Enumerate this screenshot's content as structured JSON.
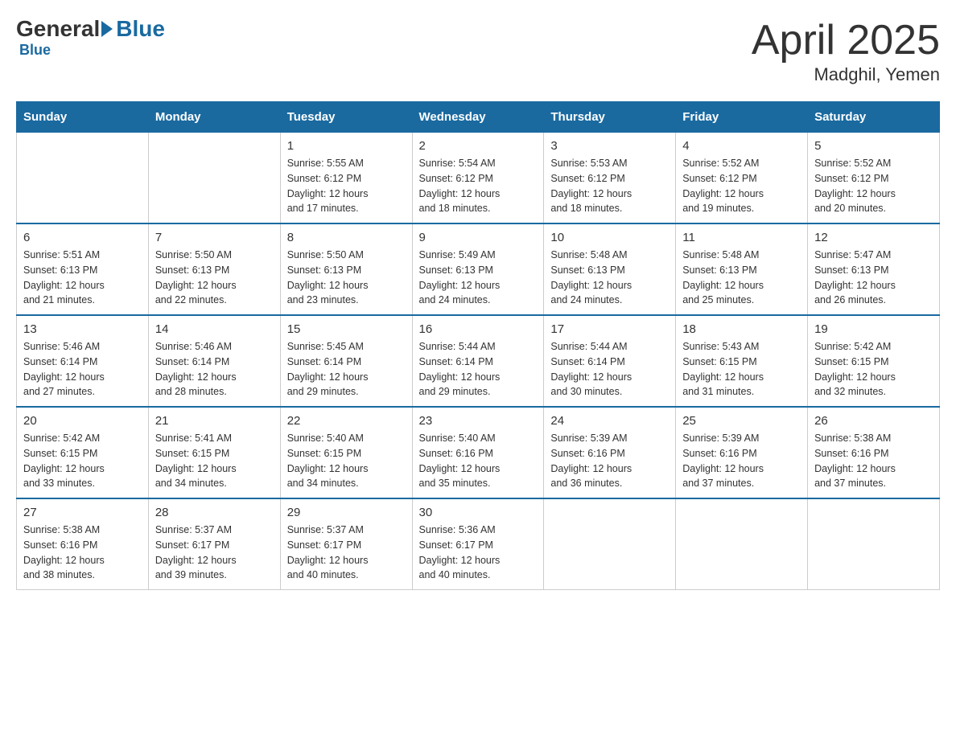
{
  "logo": {
    "general": "General",
    "blue": "Blue"
  },
  "title": {
    "month": "April 2025",
    "location": "Madghil, Yemen"
  },
  "header_days": [
    "Sunday",
    "Monday",
    "Tuesday",
    "Wednesday",
    "Thursday",
    "Friday",
    "Saturday"
  ],
  "weeks": [
    [
      {
        "day": "",
        "info": ""
      },
      {
        "day": "",
        "info": ""
      },
      {
        "day": "1",
        "info": "Sunrise: 5:55 AM\nSunset: 6:12 PM\nDaylight: 12 hours\nand 17 minutes."
      },
      {
        "day": "2",
        "info": "Sunrise: 5:54 AM\nSunset: 6:12 PM\nDaylight: 12 hours\nand 18 minutes."
      },
      {
        "day": "3",
        "info": "Sunrise: 5:53 AM\nSunset: 6:12 PM\nDaylight: 12 hours\nand 18 minutes."
      },
      {
        "day": "4",
        "info": "Sunrise: 5:52 AM\nSunset: 6:12 PM\nDaylight: 12 hours\nand 19 minutes."
      },
      {
        "day": "5",
        "info": "Sunrise: 5:52 AM\nSunset: 6:12 PM\nDaylight: 12 hours\nand 20 minutes."
      }
    ],
    [
      {
        "day": "6",
        "info": "Sunrise: 5:51 AM\nSunset: 6:13 PM\nDaylight: 12 hours\nand 21 minutes."
      },
      {
        "day": "7",
        "info": "Sunrise: 5:50 AM\nSunset: 6:13 PM\nDaylight: 12 hours\nand 22 minutes."
      },
      {
        "day": "8",
        "info": "Sunrise: 5:50 AM\nSunset: 6:13 PM\nDaylight: 12 hours\nand 23 minutes."
      },
      {
        "day": "9",
        "info": "Sunrise: 5:49 AM\nSunset: 6:13 PM\nDaylight: 12 hours\nand 24 minutes."
      },
      {
        "day": "10",
        "info": "Sunrise: 5:48 AM\nSunset: 6:13 PM\nDaylight: 12 hours\nand 24 minutes."
      },
      {
        "day": "11",
        "info": "Sunrise: 5:48 AM\nSunset: 6:13 PM\nDaylight: 12 hours\nand 25 minutes."
      },
      {
        "day": "12",
        "info": "Sunrise: 5:47 AM\nSunset: 6:13 PM\nDaylight: 12 hours\nand 26 minutes."
      }
    ],
    [
      {
        "day": "13",
        "info": "Sunrise: 5:46 AM\nSunset: 6:14 PM\nDaylight: 12 hours\nand 27 minutes."
      },
      {
        "day": "14",
        "info": "Sunrise: 5:46 AM\nSunset: 6:14 PM\nDaylight: 12 hours\nand 28 minutes."
      },
      {
        "day": "15",
        "info": "Sunrise: 5:45 AM\nSunset: 6:14 PM\nDaylight: 12 hours\nand 29 minutes."
      },
      {
        "day": "16",
        "info": "Sunrise: 5:44 AM\nSunset: 6:14 PM\nDaylight: 12 hours\nand 29 minutes."
      },
      {
        "day": "17",
        "info": "Sunrise: 5:44 AM\nSunset: 6:14 PM\nDaylight: 12 hours\nand 30 minutes."
      },
      {
        "day": "18",
        "info": "Sunrise: 5:43 AM\nSunset: 6:15 PM\nDaylight: 12 hours\nand 31 minutes."
      },
      {
        "day": "19",
        "info": "Sunrise: 5:42 AM\nSunset: 6:15 PM\nDaylight: 12 hours\nand 32 minutes."
      }
    ],
    [
      {
        "day": "20",
        "info": "Sunrise: 5:42 AM\nSunset: 6:15 PM\nDaylight: 12 hours\nand 33 minutes."
      },
      {
        "day": "21",
        "info": "Sunrise: 5:41 AM\nSunset: 6:15 PM\nDaylight: 12 hours\nand 34 minutes."
      },
      {
        "day": "22",
        "info": "Sunrise: 5:40 AM\nSunset: 6:15 PM\nDaylight: 12 hours\nand 34 minutes."
      },
      {
        "day": "23",
        "info": "Sunrise: 5:40 AM\nSunset: 6:16 PM\nDaylight: 12 hours\nand 35 minutes."
      },
      {
        "day": "24",
        "info": "Sunrise: 5:39 AM\nSunset: 6:16 PM\nDaylight: 12 hours\nand 36 minutes."
      },
      {
        "day": "25",
        "info": "Sunrise: 5:39 AM\nSunset: 6:16 PM\nDaylight: 12 hours\nand 37 minutes."
      },
      {
        "day": "26",
        "info": "Sunrise: 5:38 AM\nSunset: 6:16 PM\nDaylight: 12 hours\nand 37 minutes."
      }
    ],
    [
      {
        "day": "27",
        "info": "Sunrise: 5:38 AM\nSunset: 6:16 PM\nDaylight: 12 hours\nand 38 minutes."
      },
      {
        "day": "28",
        "info": "Sunrise: 5:37 AM\nSunset: 6:17 PM\nDaylight: 12 hours\nand 39 minutes."
      },
      {
        "day": "29",
        "info": "Sunrise: 5:37 AM\nSunset: 6:17 PM\nDaylight: 12 hours\nand 40 minutes."
      },
      {
        "day": "30",
        "info": "Sunrise: 5:36 AM\nSunset: 6:17 PM\nDaylight: 12 hours\nand 40 minutes."
      },
      {
        "day": "",
        "info": ""
      },
      {
        "day": "",
        "info": ""
      },
      {
        "day": "",
        "info": ""
      }
    ]
  ]
}
